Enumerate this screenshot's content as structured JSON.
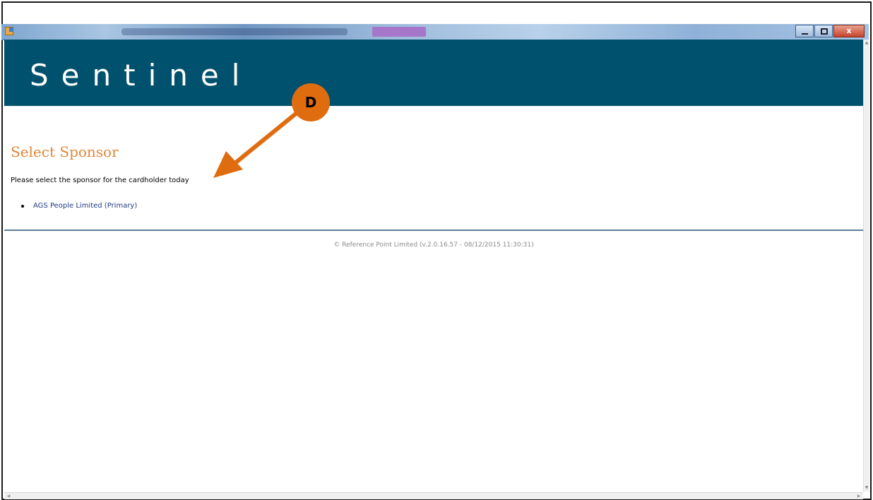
{
  "window": {
    "controls": {
      "minimize": "–",
      "maximize": "□",
      "close": "x"
    }
  },
  "banner": {
    "brand": "Sentinel"
  },
  "main": {
    "title": "Select Sponsor",
    "instruction": "Please select the sponsor for the cardholder today",
    "sponsors": [
      {
        "label": "AGS People Limited (Primary)"
      }
    ]
  },
  "footer": {
    "text": "© Reference Point Limited (v.2.0.16.57 - 08/12/2015 11:30:31)"
  },
  "annotation": {
    "badge": "D"
  },
  "colors": {
    "banner_bg": "#00516d",
    "title_accent": "#e0873a",
    "link": "#1f3b82",
    "annotation": "#e06c10"
  }
}
